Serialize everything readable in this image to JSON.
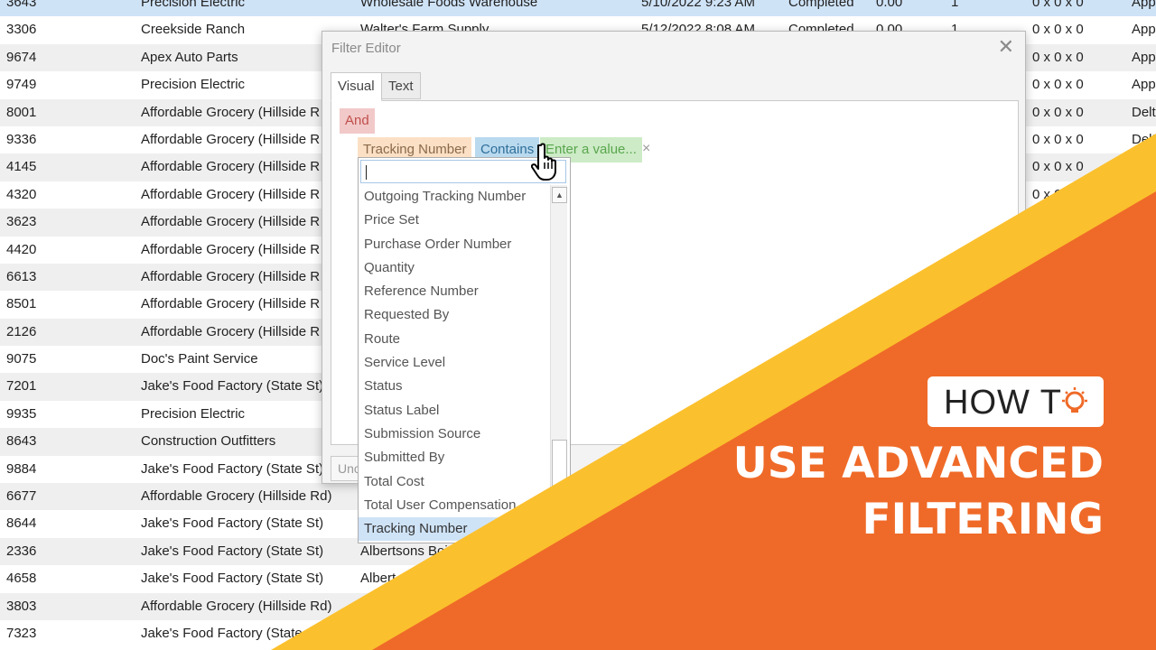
{
  "grid": {
    "rows": [
      [
        "3643",
        "Precision Electric",
        "Wholesale Foods Warehouse",
        "5/10/2022 9:23 AM",
        "Completed",
        "0.00",
        "1",
        "0 x 0 x 0",
        "App"
      ],
      [
        "3306",
        "Creekside Ranch",
        "Walter's Farm Supply",
        "5/12/2022 8:08 AM",
        "Completed",
        "0.00",
        "1",
        "0 x 0 x 0",
        "App"
      ],
      [
        "9674",
        "Apex Auto Parts",
        "",
        "",
        "",
        "",
        "",
        "0 x 0 x 0",
        "App"
      ],
      [
        "9749",
        "Precision Electric",
        "",
        "",
        "",
        "",
        "",
        "0 x 0 x 0",
        "App"
      ],
      [
        "8001",
        "Affordable Grocery (Hillside R",
        "",
        "",
        "",
        "",
        "",
        "0 x 0 x 0",
        "Delt"
      ],
      [
        "9336",
        "Affordable Grocery (Hillside R",
        "",
        "",
        "",
        "",
        "",
        "0 x 0 x 0",
        "Delt"
      ],
      [
        "4145",
        "Affordable Grocery (Hillside R",
        "",
        "",
        "",
        "",
        "",
        "0 x 0 x 0",
        ""
      ],
      [
        "4320",
        "Affordable Grocery (Hillside R",
        "",
        "",
        "",
        "",
        "",
        "0 x 0",
        ""
      ],
      [
        "3623",
        "Affordable Grocery (Hillside R",
        "",
        "",
        "",
        "",
        "",
        "",
        ""
      ],
      [
        "4420",
        "Affordable Grocery (Hillside R",
        "",
        "",
        "",
        "",
        "",
        "",
        ""
      ],
      [
        "6613",
        "Affordable Grocery (Hillside R",
        "",
        "",
        "",
        "",
        "",
        "",
        ""
      ],
      [
        "8501",
        "Affordable Grocery (Hillside R",
        "",
        "",
        "",
        "",
        "",
        "",
        ""
      ],
      [
        "2126",
        "Affordable Grocery (Hillside R",
        "",
        "",
        "",
        "",
        "",
        "",
        ""
      ],
      [
        "9075",
        "Doc's Paint Service",
        "",
        "",
        "",
        "",
        "",
        "",
        ""
      ],
      [
        "7201",
        "Jake's Food Factory (State St)",
        "",
        "",
        "",
        "",
        "",
        "",
        ""
      ],
      [
        "9935",
        "Precision Electric",
        "",
        "",
        "",
        "",
        "",
        "",
        ""
      ],
      [
        "8643",
        "Construction Outfitters",
        "",
        "",
        "",
        "",
        "",
        "",
        ""
      ],
      [
        "9884",
        "Jake's Food Factory (State St)",
        "",
        "",
        "",
        "",
        "",
        "",
        ""
      ],
      [
        "6677",
        "Affordable Grocery (Hillside Rd)",
        "",
        "",
        "",
        "",
        "",
        "",
        ""
      ],
      [
        "8644",
        "Jake's Food Factory (State St)",
        "",
        "",
        "",
        "",
        "",
        "",
        ""
      ],
      [
        "2336",
        "Jake's Food Factory (State St)",
        "Albertsons Boi",
        "",
        "",
        "",
        "",
        "",
        ""
      ],
      [
        "4658",
        "Jake's Food Factory (State St)",
        "Albert",
        "",
        "",
        "",
        "",
        "",
        ""
      ],
      [
        "3803",
        "Affordable Grocery (Hillside Rd)",
        "",
        "",
        "",
        "",
        "",
        "",
        ""
      ],
      [
        "7323",
        "Jake's Food Factory (State St)",
        "",
        "",
        "",
        "",
        "",
        "",
        ""
      ]
    ]
  },
  "dialog": {
    "title": "Filter Editor",
    "close": "✕",
    "tabs": {
      "visual": "Visual",
      "text": "Text"
    },
    "undo": "Unc",
    "group_operator": "And",
    "condition": {
      "field": "Tracking Number",
      "operator": "Contains",
      "value_placeholder": "Enter a value...",
      "remove": "×"
    }
  },
  "dropdown": {
    "search_value": "",
    "items": [
      "Outgoing Tracking Number",
      "Price Set",
      "Purchase Order Number",
      "Quantity",
      "Reference Number",
      "Requested By",
      "Route",
      "Service Level",
      "Status",
      "Status Label",
      "Submission Source",
      "Submitted By",
      "Total Cost",
      "Total User Compensation",
      "Tracking Number"
    ],
    "selected": "Tracking Number"
  },
  "banner": {
    "badge": "HOW T",
    "line1": "USE ADVANCED",
    "line2": "FILTERING",
    "colors": {
      "yellow": "#fbc02d",
      "orange": "#ef6a28",
      "white": "#ffffff"
    }
  }
}
